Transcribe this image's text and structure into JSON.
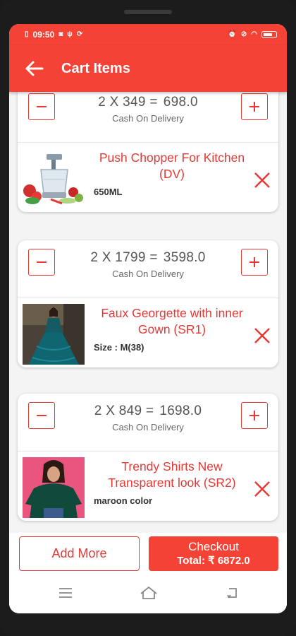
{
  "status_bar": {
    "time": "09:50",
    "icons_left": [
      "sim-icon",
      "whatsapp-icon",
      "usb-icon",
      "sync-icon"
    ],
    "icons_right": [
      "alarm-icon",
      "mute-icon",
      "wifi-icon",
      "battery-icon"
    ]
  },
  "app_bar": {
    "back_icon": "arrow-left-icon",
    "title": "Cart Items"
  },
  "cart": {
    "items": [
      {
        "quantity": "2",
        "unit_price": "349",
        "line_total": "698.0",
        "calc_text": "2 X 349 =",
        "payment": "Cash On Delivery",
        "name": "Push Chopper For Kitchen (DV)",
        "variant": "650ML"
      },
      {
        "quantity": "2",
        "unit_price": "1799",
        "line_total": "3598.0",
        "calc_text": "2 X 1799 =",
        "payment": "Cash On Delivery",
        "name": "Faux Georgette with inner Gown (SR1)",
        "variant": "Size : M(38)"
      },
      {
        "quantity": "2",
        "unit_price": "849",
        "line_total": "1698.0",
        "calc_text": "2 X 849 =",
        "payment": "Cash On Delivery",
        "name": "Trendy Shirts New Transparent look (SR2)",
        "variant": "maroon color"
      }
    ]
  },
  "actions": {
    "add_more_label": "Add More",
    "checkout_label": "Checkout",
    "total_label": "Total: ₹ 6872.0"
  },
  "nav": {
    "icons": [
      "menu-icon",
      "home-icon",
      "back-icon"
    ]
  },
  "colors": {
    "primary": "#f44336",
    "accent_red": "#e53935",
    "text_gray": "#555555"
  }
}
